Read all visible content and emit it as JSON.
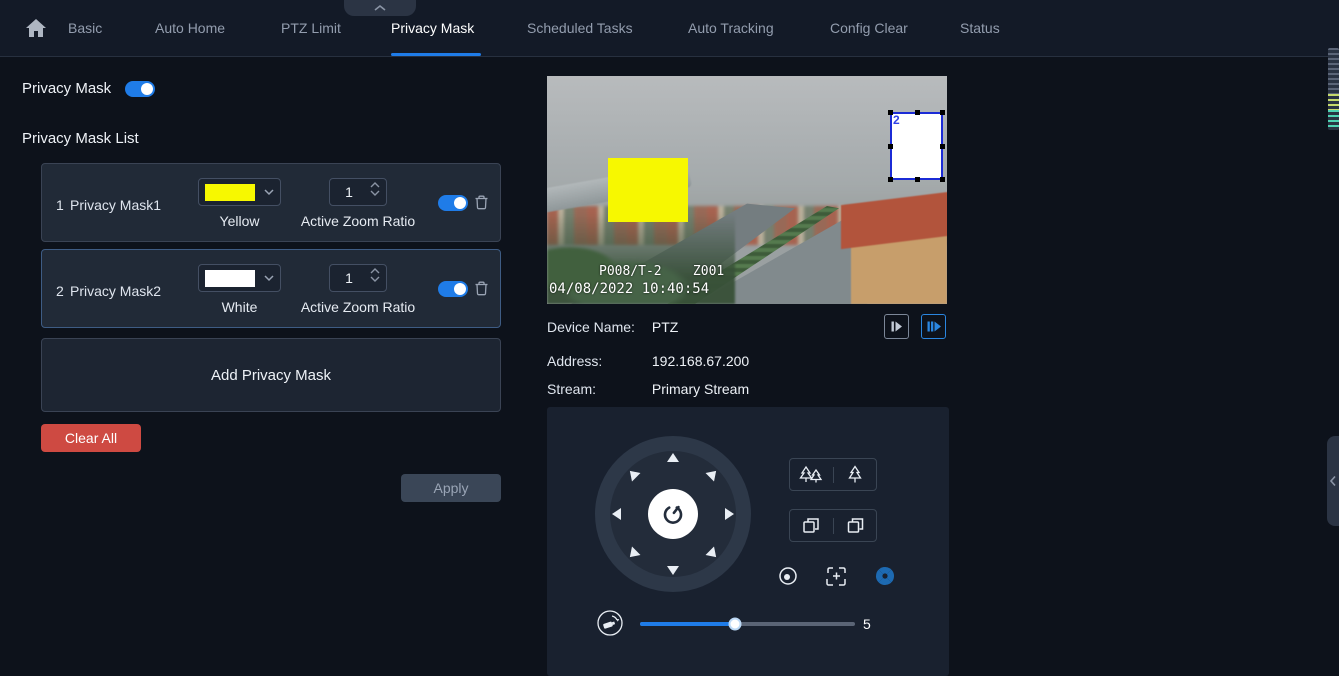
{
  "nav": {
    "tabs": [
      {
        "label": "Basic"
      },
      {
        "label": "Auto Home"
      },
      {
        "label": "PTZ Limit"
      },
      {
        "label": "Privacy Mask"
      },
      {
        "label": "Scheduled Tasks"
      },
      {
        "label": "Auto Tracking"
      },
      {
        "label": "Config Clear"
      },
      {
        "label": "Status"
      }
    ],
    "active_tab": "Privacy Mask"
  },
  "left": {
    "privacy_mask_label": "Privacy Mask",
    "privacy_mask_enabled": true,
    "list_title": "Privacy Mask List",
    "masks": [
      {
        "index": "1",
        "name": "Privacy Mask1",
        "color_name": "Yellow",
        "swatch_style": "background:#f7f800",
        "zoom_ratio": "1",
        "zoom_ratio_label": "Active Zoom Ratio",
        "enabled": true,
        "selected": false
      },
      {
        "index": "2",
        "name": "Privacy Mask2",
        "color_name": "White",
        "swatch_style": "background:#ffffff",
        "zoom_ratio": "1",
        "zoom_ratio_label": "Active Zoom Ratio",
        "enabled": true,
        "selected": true
      }
    ],
    "add_button_label": "Add Privacy Mask",
    "clear_all_label": "Clear All",
    "apply_label": "Apply"
  },
  "video": {
    "osd_line1": "P008/T-2    Z001",
    "osd_line2": "04/08/2022 10:40:54",
    "overlay_masks": [
      {
        "id": "1",
        "fill": "#f7f800",
        "selected": false
      },
      {
        "id": "2",
        "fill": "#ffffff",
        "border": "#1b2bd6",
        "label": "2",
        "selected": true
      }
    ]
  },
  "device": {
    "name_label": "Device Name:",
    "name_value": "PTZ",
    "address_label": "Address:",
    "address_value": "192.168.67.200",
    "stream_label": "Stream:",
    "stream_value": "Primary Stream"
  },
  "ptz": {
    "speed_value": "5",
    "slider_fill_style": "width:44%",
    "slider_handle_style": "left:44%",
    "icons": [
      "power",
      "zoom-out-trees",
      "zoom-in-tree",
      "focus-far",
      "focus-near",
      "iris-dot",
      "focus-auto",
      "aperture",
      "speed-camera",
      "step-play",
      "multi-step-play"
    ]
  },
  "colors": {
    "accent_blue": "#1f7ce8",
    "danger_red": "#ce4a42",
    "selected_border": "#3e5c84",
    "mask_yellow": "#f7f800",
    "mask_white": "#ffffff",
    "mask_outline_blue": "#1b2bd6"
  }
}
